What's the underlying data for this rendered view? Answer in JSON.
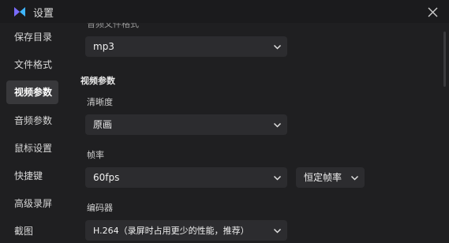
{
  "window": {
    "title": "设置"
  },
  "sidebar": {
    "items": [
      {
        "label": "保存目录"
      },
      {
        "label": "文件格式"
      },
      {
        "label": "视频参数"
      },
      {
        "label": "音频参数"
      },
      {
        "label": "鼠标设置"
      },
      {
        "label": "快捷键"
      },
      {
        "label": "高级录屏"
      },
      {
        "label": "截图"
      }
    ],
    "active_index": 2
  },
  "content": {
    "audio_format_label_partial": "音频文件格式",
    "audio_format_value": "mp3",
    "video_section_title": "视频参数",
    "clarity_label": "清晰度",
    "clarity_value": "原画",
    "framerate_label": "帧率",
    "framerate_value": "60fps",
    "framerate_mode_value": "恒定帧率",
    "encoder_label": "编码器",
    "encoder_value": "H.264（录屏时占用更少的性能，推荐）"
  },
  "colors": {
    "background": "#1f1f21",
    "control_bg": "#2c2c2f",
    "active_item_bg": "#38383b",
    "accent_logo": "#6c5cf0"
  }
}
